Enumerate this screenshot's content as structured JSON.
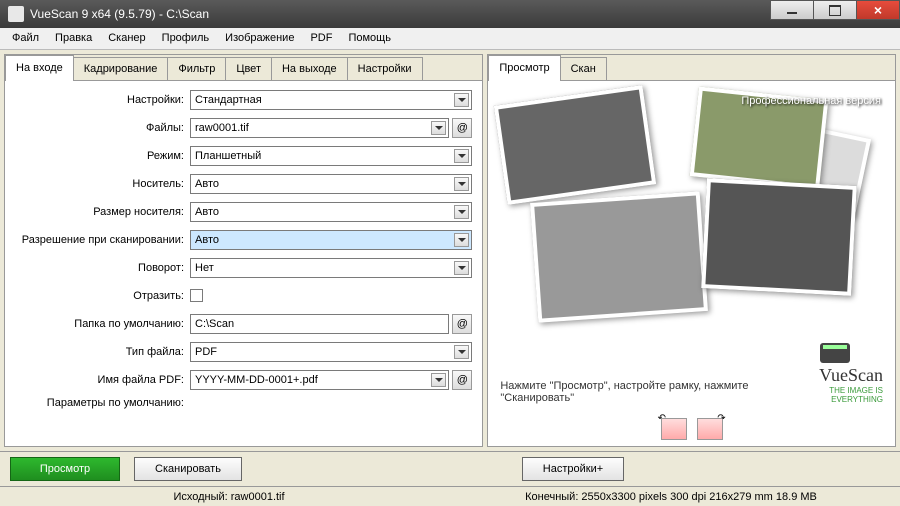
{
  "window": {
    "title": "VueScan 9 x64 (9.5.79) - C:\\Scan"
  },
  "menu": [
    "Файл",
    "Правка",
    "Сканер",
    "Профиль",
    "Изображение",
    "PDF",
    "Помощь"
  ],
  "leftTabs": [
    {
      "label": "На входе"
    },
    {
      "label": "Кадрирование"
    },
    {
      "label": "Фильтр"
    },
    {
      "label": "Цвет"
    },
    {
      "label": "На выходе"
    },
    {
      "label": "Настройки"
    }
  ],
  "rightTabs": [
    {
      "label": "Просмотр"
    },
    {
      "label": "Скан"
    }
  ],
  "form": {
    "settings": {
      "label": "Настройки:",
      "value": "Стандартная"
    },
    "files": {
      "label": "Файлы:",
      "value": "raw0001.tif"
    },
    "mode": {
      "label": "Режим:",
      "value": "Планшетный"
    },
    "media": {
      "label": "Носитель:",
      "value": "Авто"
    },
    "mediaSize": {
      "label": "Размер носителя:",
      "value": "Авто"
    },
    "resolution": {
      "label": "Разрешение при сканировании:",
      "value": "Авто"
    },
    "rotate": {
      "label": "Поворот:",
      "value": "Нет"
    },
    "mirror": {
      "label": "Отразить:"
    },
    "folder": {
      "label": "Папка по умолчанию:",
      "value": "C:\\Scan"
    },
    "filetype": {
      "label": "Тип файла:",
      "value": "PDF"
    },
    "pdfname": {
      "label": "Имя файла PDF:",
      "value": "YYYY-MM-DD-0001+.pdf"
    },
    "defaults": {
      "label": "Параметры по умолчанию:"
    }
  },
  "buttons": {
    "preview": "Просмотр",
    "scan": "Сканировать",
    "settings": "Настройки+"
  },
  "status": {
    "src": "Исходный: raw0001.tif",
    "dst": "Конечный: 2550x3300 pixels 300 dpi 216x279 mm 18.9 MB"
  },
  "preview": {
    "version": "Профессиональная версия",
    "hint": "Нажмите \"Просмотр\", настройте рамку, нажмите \"Сканировать\"",
    "logoName": "VueScan",
    "logoTag": "THE IMAGE IS EVERYTHING"
  },
  "at": "@"
}
